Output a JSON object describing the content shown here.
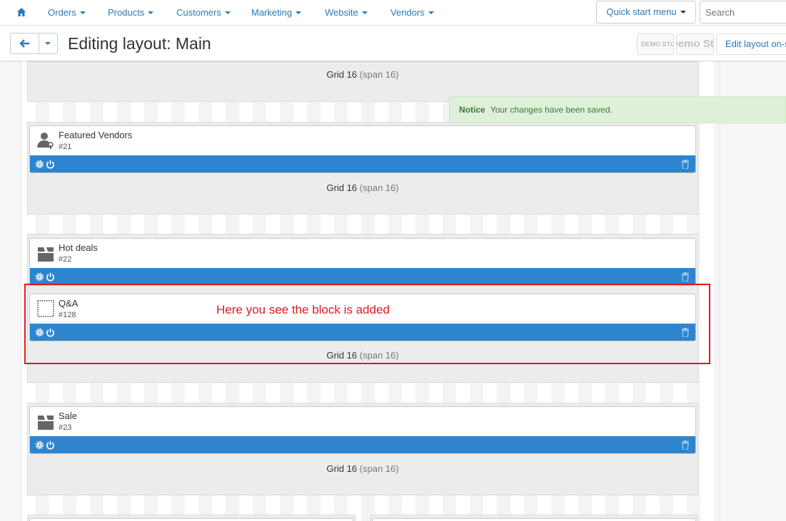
{
  "nav": {
    "items": [
      "Orders",
      "Products",
      "Customers",
      "Marketing",
      "Website",
      "Vendors"
    ],
    "quick_start": "Quick start menu",
    "search_placeholder": "Search"
  },
  "toolbar": {
    "title": "Editing layout: Main",
    "logo1": "DEMO STORE",
    "logo2": "Demo Store",
    "edit_layout": "Edit layout on-site"
  },
  "notice": {
    "title": "Notice",
    "text": "Your changes have been saved."
  },
  "grids": [
    {
      "label": "Grid 16",
      "span": "(span 16)"
    },
    {
      "label": "Grid 16",
      "span": "(span 16)"
    },
    {
      "label": "Grid 16",
      "span": "(span 16)"
    },
    {
      "label": "Grid 16",
      "span": "(span 16)"
    }
  ],
  "blocks": [
    {
      "name": "Featured Vendors",
      "id": "#21",
      "icon": "vendor-icon"
    },
    {
      "name": "Hot deals",
      "id": "#22",
      "icon": "box-icon"
    },
    {
      "name": "Q&A",
      "id": "#128",
      "icon": "dotted-square-icon"
    },
    {
      "name": "Sale",
      "id": "#23",
      "icon": "box-icon"
    }
  ],
  "annotation": "Here you see the block is added",
  "colors": {
    "accent": "#2d85cf",
    "link": "#2a7ab8",
    "notice_bg": "#dff0d8",
    "annotation": "#e0191f"
  }
}
